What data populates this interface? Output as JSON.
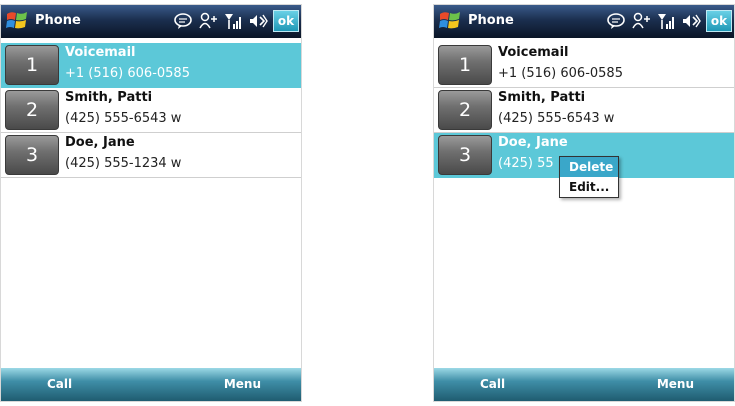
{
  "screens": [
    {
      "title": "Phone",
      "ok_label": "ok",
      "contacts": [
        {
          "slot": "1",
          "name": "Voicemail",
          "number": "+1 (516) 606-0585"
        },
        {
          "slot": "2",
          "name": "Smith, Patti",
          "number": "(425) 555-6543 w"
        },
        {
          "slot": "3",
          "name": "Doe, Jane",
          "number": "(425) 555-1234 w"
        }
      ],
      "softkeys": {
        "left": "Call",
        "right": "Menu"
      }
    },
    {
      "title": "Phone",
      "ok_label": "ok",
      "contacts": [
        {
          "slot": "1",
          "name": "Voicemail",
          "number": "+1 (516) 606-0585"
        },
        {
          "slot": "2",
          "name": "Smith, Patti",
          "number": "(425) 555-6543 w"
        },
        {
          "slot": "3",
          "name": "Doe, Jane",
          "number": "(425) 55"
        }
      ],
      "context_menu": [
        "Delete",
        "Edit..."
      ],
      "softkeys": {
        "left": "Call",
        "right": "Menu"
      }
    }
  ],
  "icons": [
    "windows-start-icon",
    "messaging-icon",
    "connectivity-icon",
    "signal-icon",
    "speaker-icon"
  ],
  "colors": {
    "selection": "#5cc8d8",
    "titlebar": "#1b2f4f",
    "softkey_bar": "#3f8ea7",
    "menu_highlight": "#3aa7c9"
  }
}
